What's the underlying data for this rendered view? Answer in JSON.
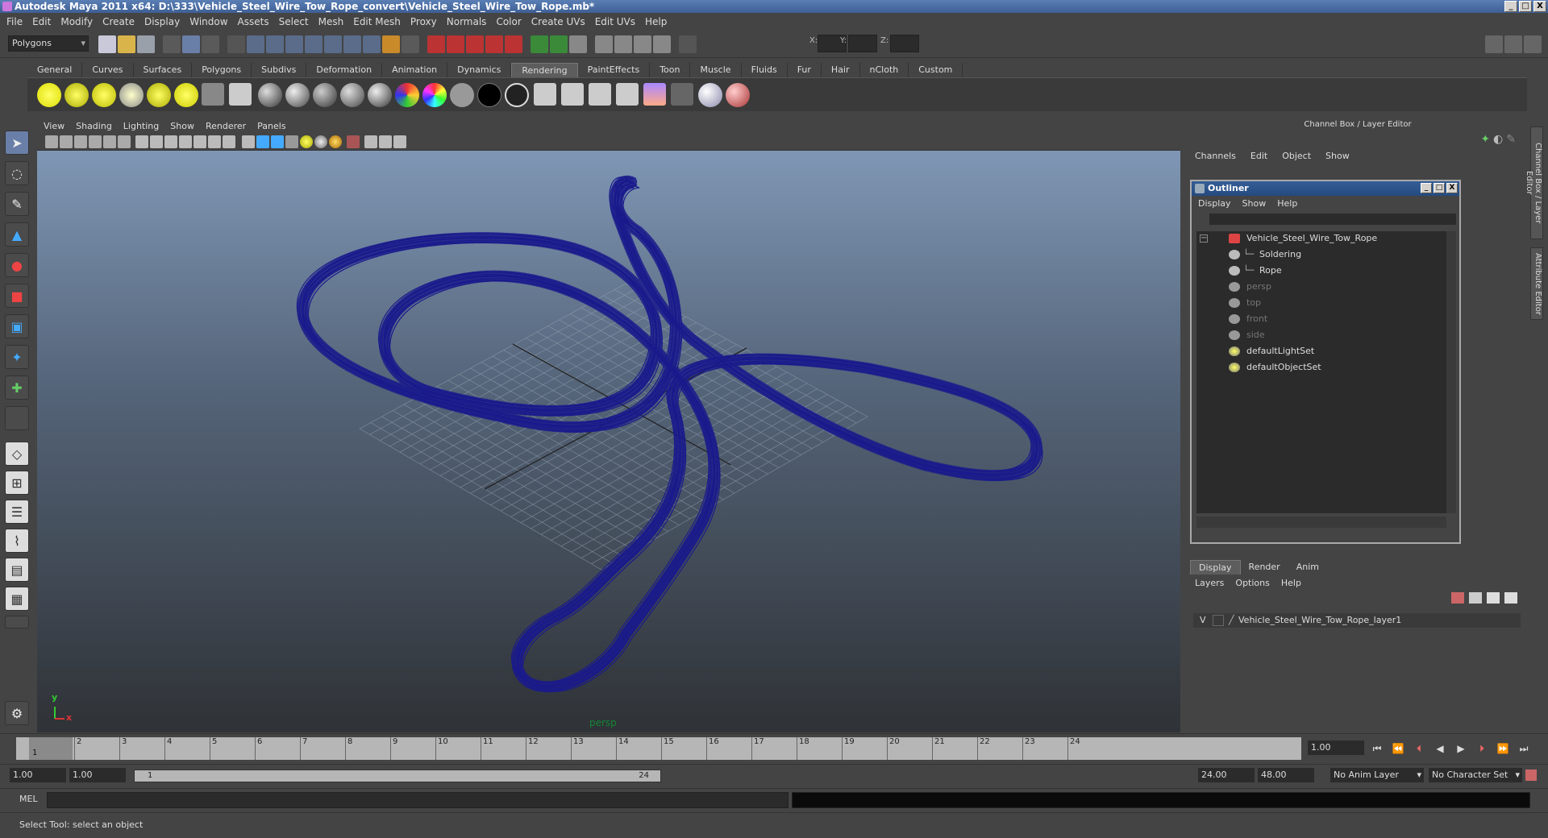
{
  "title": "Autodesk Maya 2011 x64: D:\\333\\Vehicle_Steel_Wire_Tow_Rope_convert\\Vehicle_Steel_Wire_Tow_Rope.mb*",
  "window_buttons": [
    "_",
    "□",
    "X"
  ],
  "menubar": [
    "File",
    "Edit",
    "Modify",
    "Create",
    "Display",
    "Window",
    "Assets",
    "Select",
    "Mesh",
    "Edit Mesh",
    "Proxy",
    "Normals",
    "Color",
    "Create UVs",
    "Edit UVs",
    "Help"
  ],
  "statusline": {
    "mode": "Polygons",
    "x_label": "X:",
    "y_label": "Y:",
    "z_label": "Z:"
  },
  "shelf_tabs": [
    "General",
    "Curves",
    "Surfaces",
    "Polygons",
    "Subdivs",
    "Deformation",
    "Animation",
    "Dynamics",
    "Rendering",
    "PaintEffects",
    "Toon",
    "Muscle",
    "Fluids",
    "Fur",
    "Hair",
    "nCloth",
    "Custom"
  ],
  "shelf_active_tab": "Rendering",
  "viewport": {
    "menu": [
      "View",
      "Shading",
      "Lighting",
      "Show",
      "Renderer",
      "Panels"
    ],
    "camera_label": "persp",
    "axis_y": "y",
    "axis_x": "x",
    "wire_color": "#1a1a8c"
  },
  "channel_box": {
    "title": "Channel Box / Layer Editor",
    "menu": [
      "Channels",
      "Edit",
      "Object",
      "Show"
    ],
    "side_tabs": [
      "Channel Box / Layer Editor",
      "Attribute Editor"
    ]
  },
  "outliner": {
    "title": "Outliner",
    "buttons": [
      "_",
      "□",
      "X"
    ],
    "menu": [
      "Display",
      "Show",
      "Help"
    ],
    "items": [
      {
        "label": "Vehicle_Steel_Wire_Tow_Rope",
        "icon": "group-icon",
        "dim": false,
        "expander": "−"
      },
      {
        "label": "Soldering",
        "icon": "mesh-icon",
        "dim": false
      },
      {
        "label": "Rope",
        "icon": "mesh-icon",
        "dim": false
      },
      {
        "label": "persp",
        "icon": "camera-icon",
        "dim": true
      },
      {
        "label": "top",
        "icon": "camera-icon",
        "dim": true
      },
      {
        "label": "front",
        "icon": "camera-icon",
        "dim": true
      },
      {
        "label": "side",
        "icon": "camera-icon",
        "dim": true
      },
      {
        "label": "defaultLightSet",
        "icon": "set-icon",
        "dim": false
      },
      {
        "label": "defaultObjectSet",
        "icon": "set-icon",
        "dim": false
      }
    ]
  },
  "layer_editor": {
    "tabs": [
      "Display",
      "Render",
      "Anim"
    ],
    "active_tab": "Display",
    "menu": [
      "Layers",
      "Options",
      "Help"
    ],
    "layer": {
      "visible": "V",
      "name": "Vehicle_Steel_Wire_Tow_Rope_layer1"
    }
  },
  "time_slider": {
    "ticks": [
      "1",
      "2",
      "3",
      "4",
      "5",
      "6",
      "7",
      "8",
      "9",
      "10",
      "11",
      "12",
      "13",
      "14",
      "15",
      "16",
      "17",
      "18",
      "19",
      "20",
      "21",
      "22",
      "23",
      "24"
    ],
    "current_marker": "1",
    "current_frame": "1.00"
  },
  "range_slider": {
    "start_time": "1.00",
    "playback_start": "1.00",
    "range_start_label": "1",
    "range_end_label": "24",
    "playback_end": "24.00",
    "end_time": "48.00",
    "anim_layer": "No Anim Layer",
    "character_set": "No Character Set"
  },
  "command_line": {
    "label": "MEL"
  },
  "help_line": "Select Tool: select an object"
}
